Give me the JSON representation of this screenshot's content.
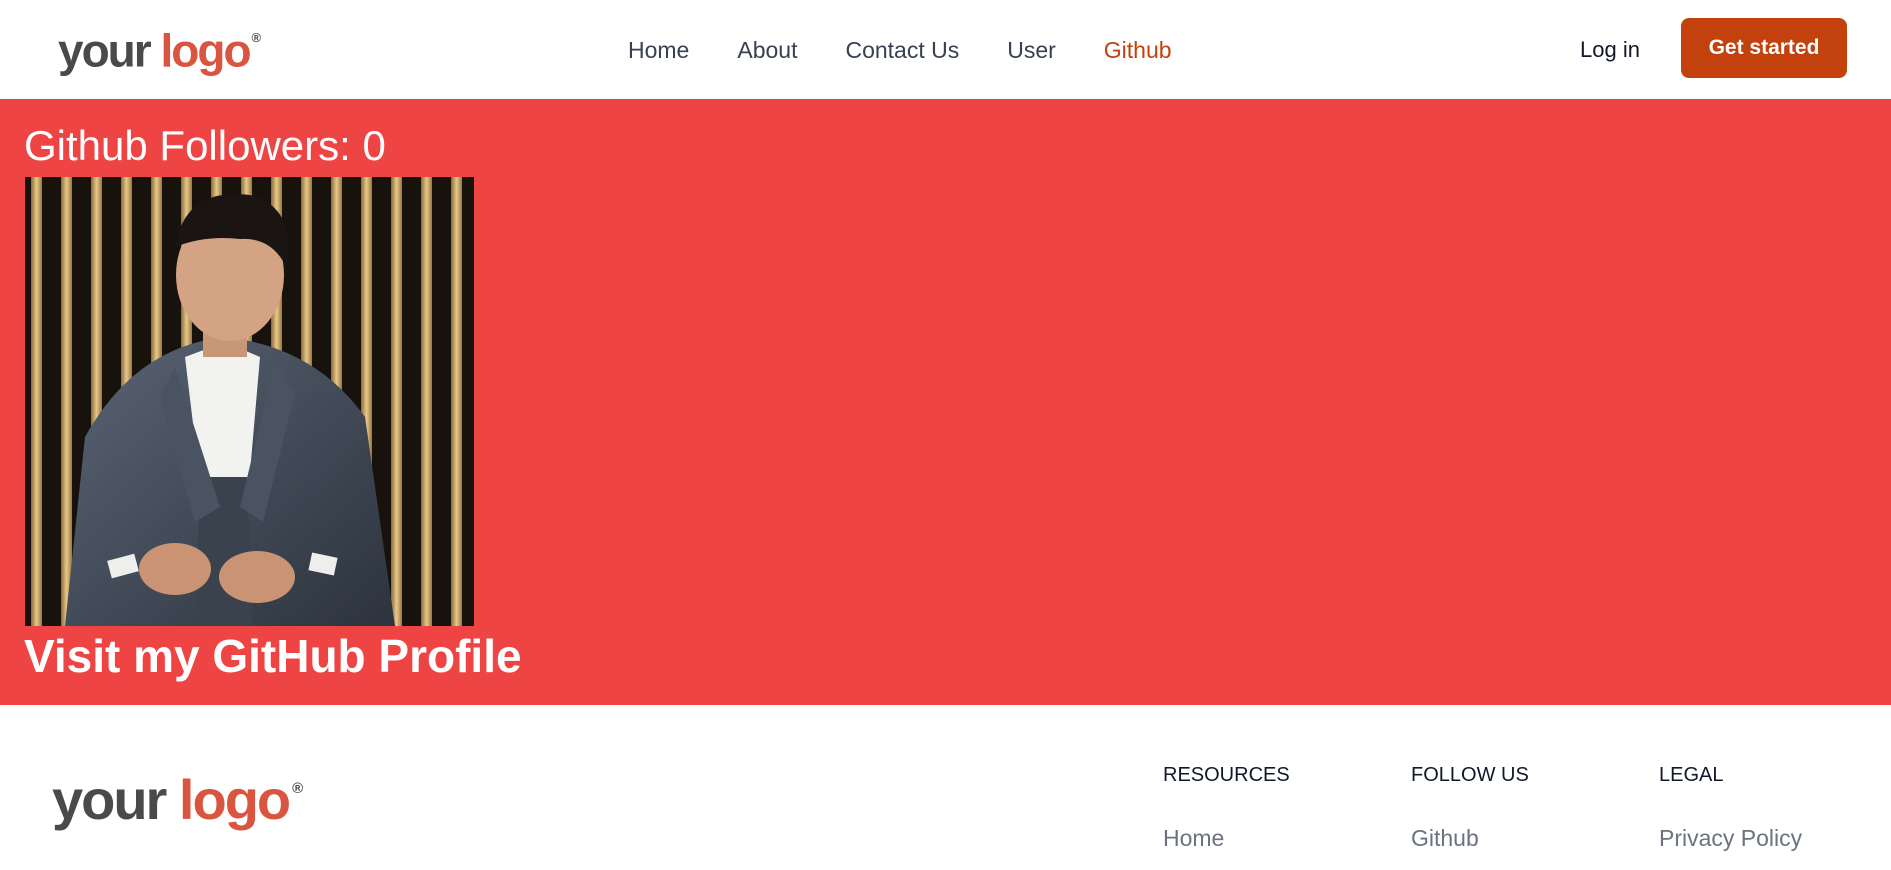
{
  "header": {
    "logo": {
      "word1": "your",
      "word2": "logo",
      "mark": "®"
    },
    "nav": [
      {
        "label": "Home"
      },
      {
        "label": "About"
      },
      {
        "label": "Contact Us"
      },
      {
        "label": "User"
      },
      {
        "label": "Github",
        "active": true
      }
    ],
    "login_label": "Log in",
    "cta_label": "Get started"
  },
  "main": {
    "followers_text": "Github Followers: 0",
    "profile_link_label": "Visit my GitHub Profile",
    "photo_icon": "profile-photo"
  },
  "footer": {
    "logo": {
      "word1": "your",
      "word2": "logo",
      "mark": "®"
    },
    "columns": [
      {
        "title": "RESOURCES",
        "link": "Home"
      },
      {
        "title": "FOLLOW US",
        "link": "Github"
      },
      {
        "title": "LEGAL",
        "link": "Privacy Policy"
      }
    ]
  },
  "colors": {
    "accent": "#c2410c",
    "main_bg": "#ef4444",
    "logo_brand": "#d9553f"
  }
}
